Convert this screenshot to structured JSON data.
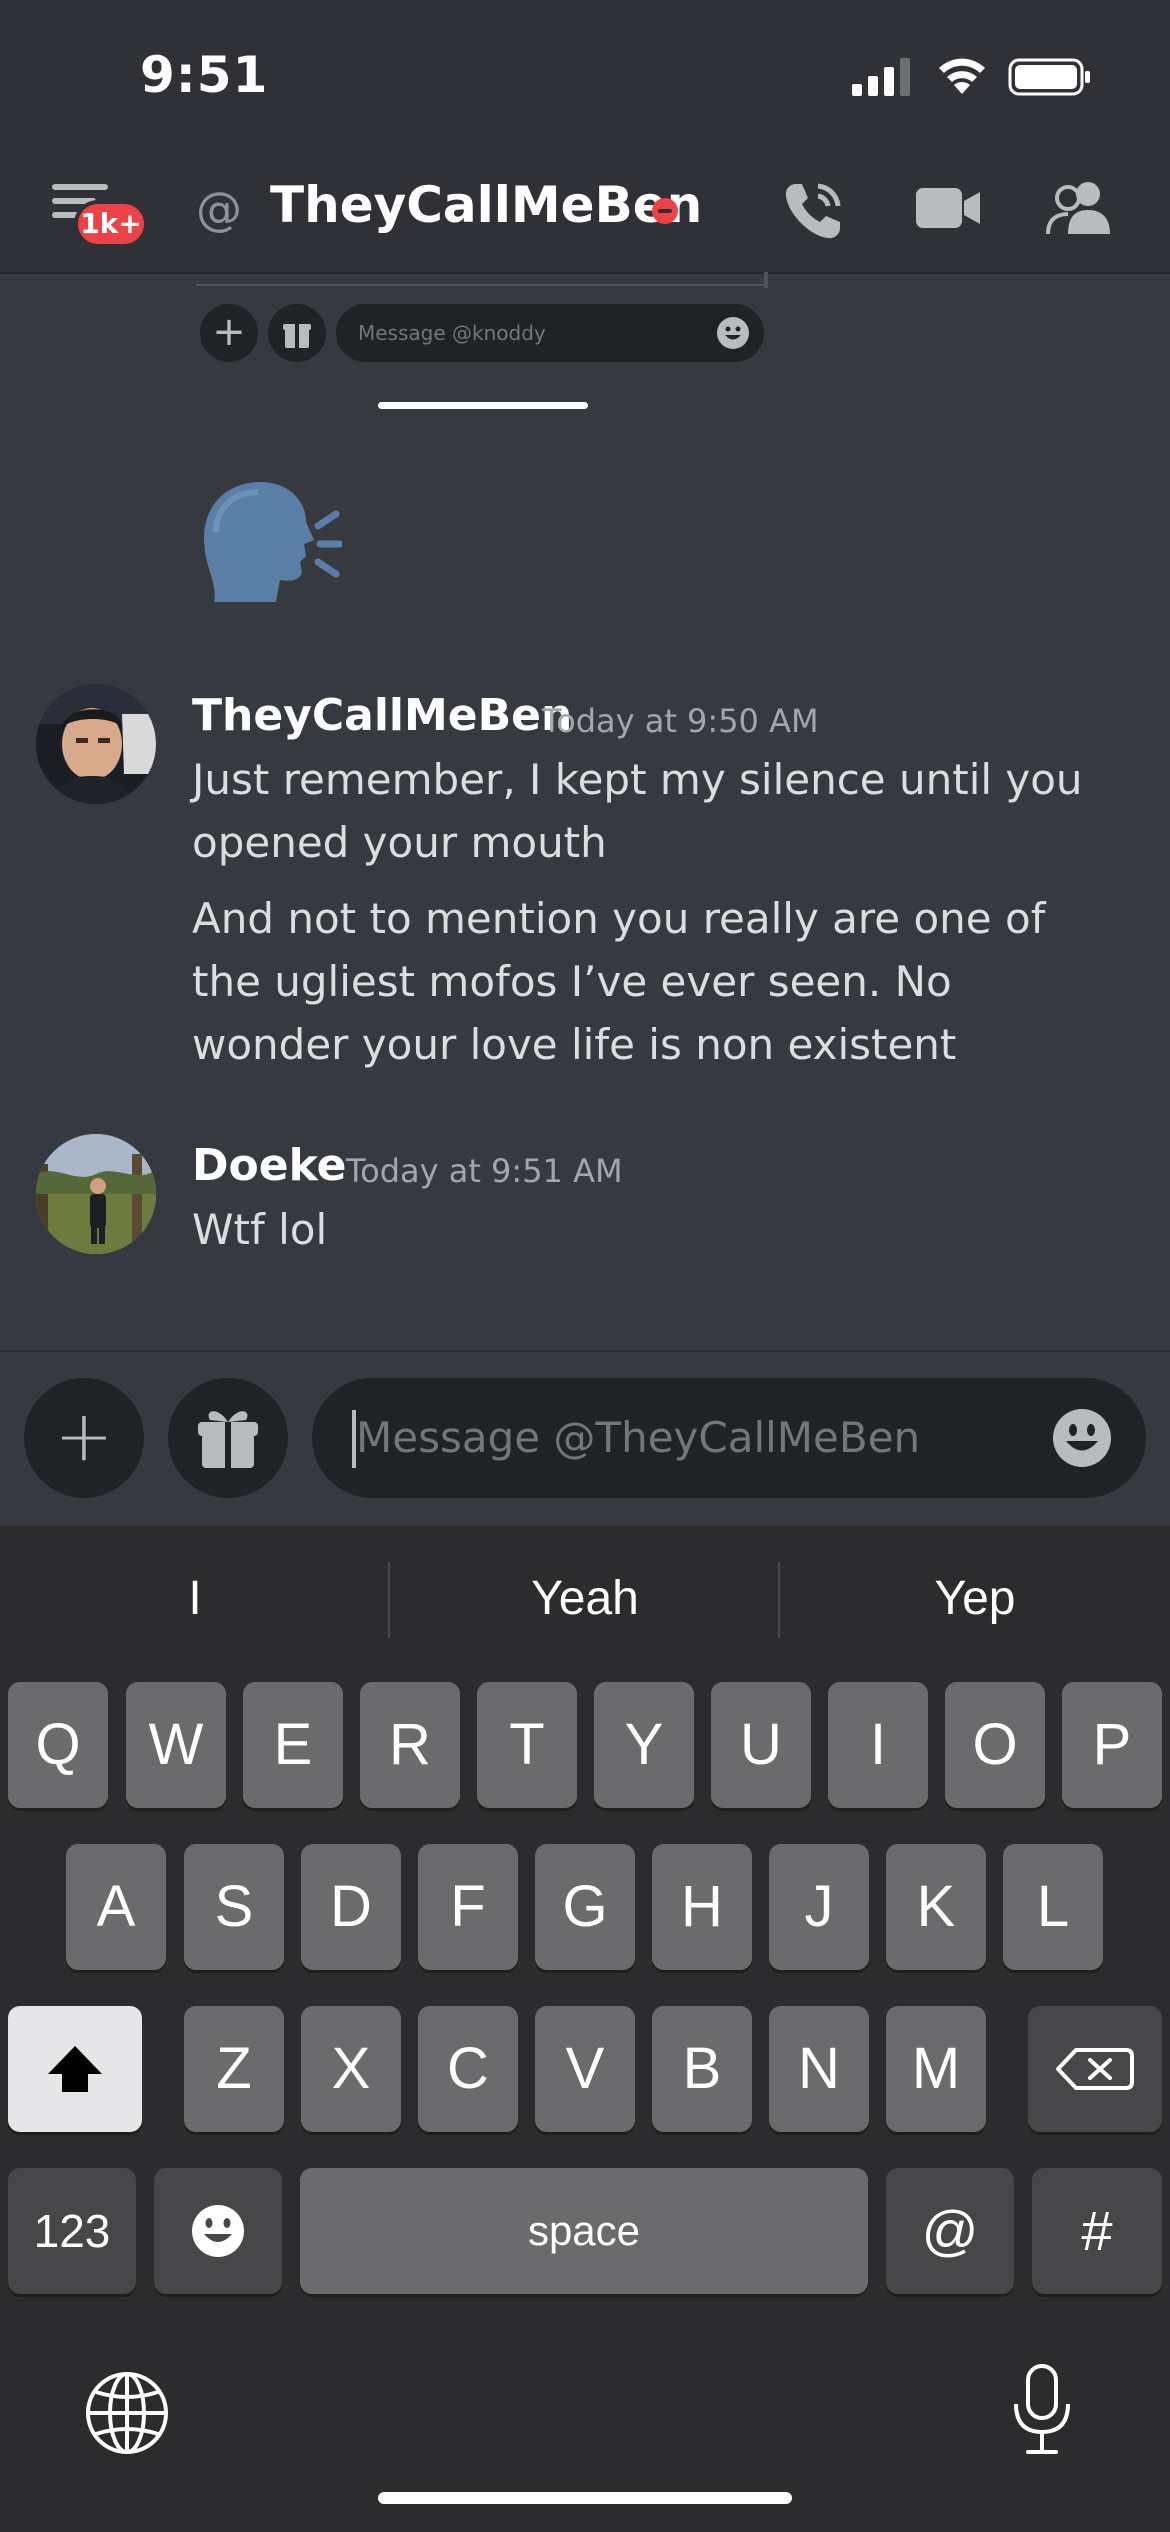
{
  "status_bar": {
    "time": "9:51"
  },
  "header": {
    "badge": "1k+",
    "at_symbol": "@",
    "title": "TheyCallMeBen"
  },
  "embedded_screenshot": {
    "input_placeholder": "Message @knoddy",
    "plus": "+"
  },
  "messages": [
    {
      "author": "TheyCallMeBen",
      "timestamp": "Today at 9:50 AM",
      "lines": [
        "Just remember, I kept my silence until you opened your mouth",
        "And not to mention you really are one of the ugliest mofos I’ve ever seen. No wonder your love life is non existent"
      ]
    },
    {
      "author": "Doeke",
      "timestamp": "Today at 9:51 AM",
      "lines": [
        "Wtf lol"
      ]
    }
  ],
  "composer": {
    "plus": "+",
    "placeholder": "Message @TheyCallMeBen"
  },
  "keyboard": {
    "suggestions": [
      "I",
      "Yeah",
      "Yep"
    ],
    "row1": [
      "Q",
      "W",
      "E",
      "R",
      "T",
      "Y",
      "U",
      "I",
      "O",
      "P"
    ],
    "row2": [
      "A",
      "S",
      "D",
      "F",
      "G",
      "H",
      "J",
      "K",
      "L"
    ],
    "row3": [
      "Z",
      "X",
      "C",
      "V",
      "B",
      "N",
      "M"
    ],
    "numbers_key": "123",
    "space_key": "space",
    "at_key": "@",
    "hash_key": "#"
  },
  "colors": {
    "background": "#36393f",
    "header": "#2f3136",
    "input": "#202225",
    "badge_red": "#ed4245"
  }
}
